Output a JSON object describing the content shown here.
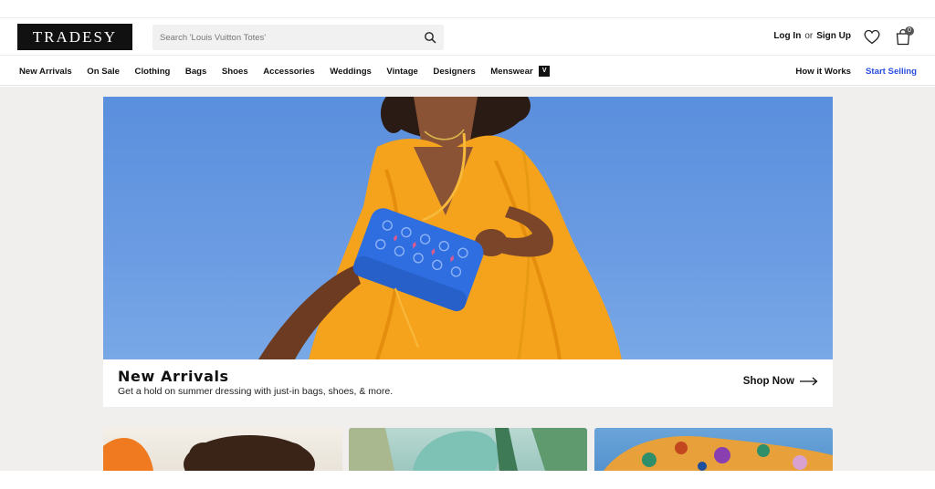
{
  "brand": {
    "logo_text": "TRADESY"
  },
  "search": {
    "placeholder": "Search 'Louis Vuitton Totes'"
  },
  "auth": {
    "login": "Log In",
    "or": "or",
    "signup": "Sign Up"
  },
  "cart": {
    "count": "0"
  },
  "nav": {
    "items": [
      "New Arrivals",
      "On Sale",
      "Clothing",
      "Bags",
      "Shoes",
      "Accessories",
      "Weddings",
      "Vintage",
      "Designers",
      "Menswear"
    ],
    "menswear_badge": "V",
    "how_it_works": "How it Works",
    "start_selling": "Start Selling"
  },
  "hero": {
    "title": "New Arrivals",
    "subtitle": "Get a hold on summer dressing with just-in bags, shoes, & more.",
    "cta": "Shop Now"
  },
  "colors": {
    "accent_link": "#2a4ee0",
    "sky": "#5a8fdd",
    "dress": "#f5a21c",
    "bag": "#2f6ee0",
    "page_bg": "#f0efed"
  }
}
